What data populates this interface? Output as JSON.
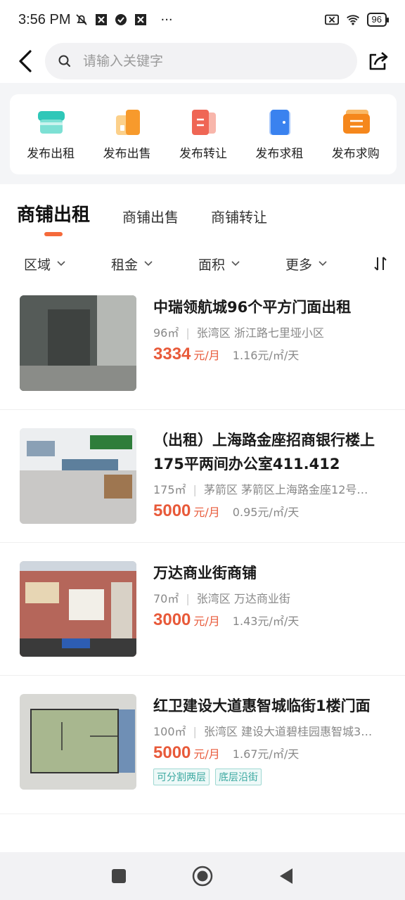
{
  "status_bar": {
    "time": "3:56 PM",
    "more": "···",
    "battery": "96"
  },
  "header": {
    "search_placeholder": "请输入关键字"
  },
  "quick_actions": [
    {
      "label": "发布出租",
      "color": "#36cfc0",
      "icon": "store-icon"
    },
    {
      "label": "发布出售",
      "color": "#f8a548",
      "icon": "building-icon"
    },
    {
      "label": "发布转让",
      "color": "#f07062",
      "icon": "transfer-icon"
    },
    {
      "label": "发布求租",
      "color": "#3d86f0",
      "icon": "door-icon"
    },
    {
      "label": "发布求购",
      "color": "#f58a1f",
      "icon": "ticket-icon"
    }
  ],
  "tabs": [
    {
      "label": "商铺出租",
      "active": true
    },
    {
      "label": "商铺出售",
      "active": false
    },
    {
      "label": "商铺转让",
      "active": false
    }
  ],
  "filters": [
    {
      "label": "区域"
    },
    {
      "label": "租金"
    },
    {
      "label": "面积"
    },
    {
      "label": "更多"
    }
  ],
  "listings": [
    {
      "title": "中瑞领航城96个平方门面出租",
      "area": "96㎡",
      "location": "张湾区 浙江路七里垭小区",
      "price": "3334",
      "price_unit": "元/月",
      "unit_price": "1.16元/㎡/天",
      "tags": []
    },
    {
      "title": "（出租）上海路金座招商银行楼上175平两间办公室411.412",
      "area": "175㎡",
      "location": "茅箭区 茅箭区上海路金座12号…",
      "price": "5000",
      "price_unit": "元/月",
      "unit_price": "0.95元/㎡/天",
      "tags": []
    },
    {
      "title": "万达商业街商铺",
      "area": "70㎡",
      "location": "张湾区 万达商业街",
      "price": "3000",
      "price_unit": "元/月",
      "unit_price": "1.43元/㎡/天",
      "tags": []
    },
    {
      "title": "红卫建设大道惠智城临街1楼门面",
      "area": "100㎡",
      "location": "张湾区 建设大道碧桂园惠智城3…",
      "price": "5000",
      "price_unit": "元/月",
      "unit_price": "1.67元/㎡/天",
      "tags": [
        "可分割两层",
        "底层沿街"
      ]
    }
  ]
}
